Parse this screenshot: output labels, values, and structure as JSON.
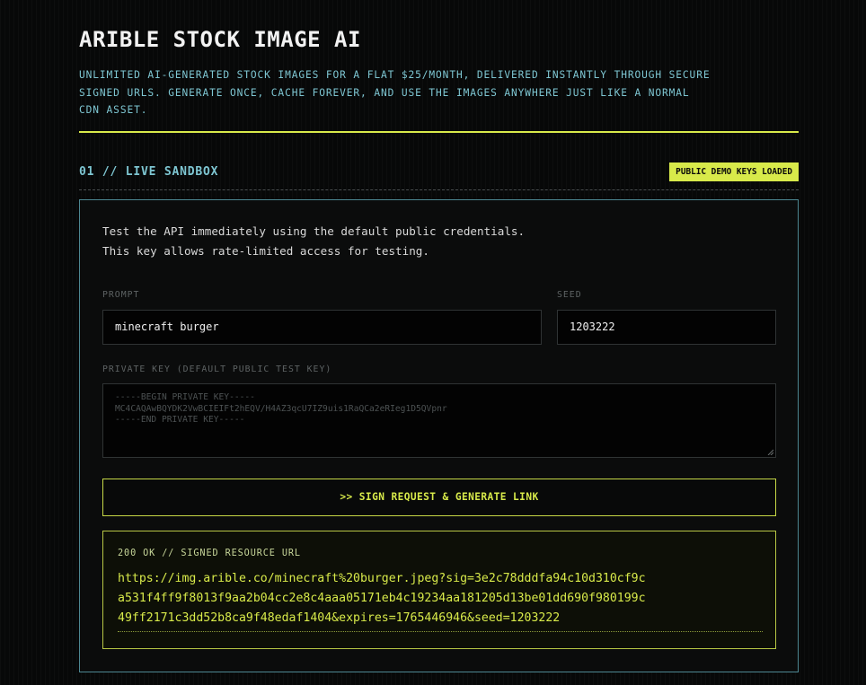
{
  "header": {
    "title": "ARIBLE STOCK IMAGE AI",
    "subtitle_lines": [
      "UNLIMITED AI-GENERATED STOCK IMAGES FOR A FLAT $25/MONTH, DELIVERED INSTANTLY THROUGH SECURE",
      "SIGNED URLS. GENERATE ONCE, CACHE FOREVER, AND USE THE IMAGES ANYWHERE JUST LIKE A NORMAL",
      "CDN ASSET."
    ]
  },
  "section": {
    "title": "01 // LIVE SANDBOX",
    "badge": "PUBLIC DEMO KEYS LOADED"
  },
  "sandbox": {
    "intro_lines": [
      "Test the API immediately using the default public credentials.",
      "This key allows rate-limited access for testing."
    ],
    "prompt": {
      "label": "PROMPT",
      "value": "minecraft burger"
    },
    "seed": {
      "label": "SEED",
      "value": "1203222"
    },
    "private_key": {
      "label": "PRIVATE KEY (DEFAULT PUBLIC TEST KEY)",
      "lines": [
        "-----BEGIN PRIVATE KEY-----",
        "MC4CAQAwBQYDK2VwBCIEIFt2hEQV/H4AZ3qcU7IZ9uis1RaQCa2eRIeg1D5QVpnr",
        "-----END PRIVATE KEY-----"
      ]
    },
    "generate_button": ">> SIGN REQUEST & GENERATE LINK",
    "result": {
      "label": "200 OK // SIGNED RESOURCE URL",
      "url_lines": [
        "https://img.arible.co/minecraft%20burger.jpeg?sig=3e2c78dddfa94c10d310cf9c",
        "a531f4ff9f8013f9aa2b04cc2e8c4aaa05171eb4c19234aa181205d13be01dd690f980199c",
        "49ff2171c3dd52b8ca9f48edaf1404&expires=1765446946&seed=1203222"
      ]
    }
  },
  "colors": {
    "background": "#070808",
    "accent_lime": "#d8ea4a",
    "accent_cyan": "#7ec6d2",
    "panel_border": "#4d8792"
  }
}
